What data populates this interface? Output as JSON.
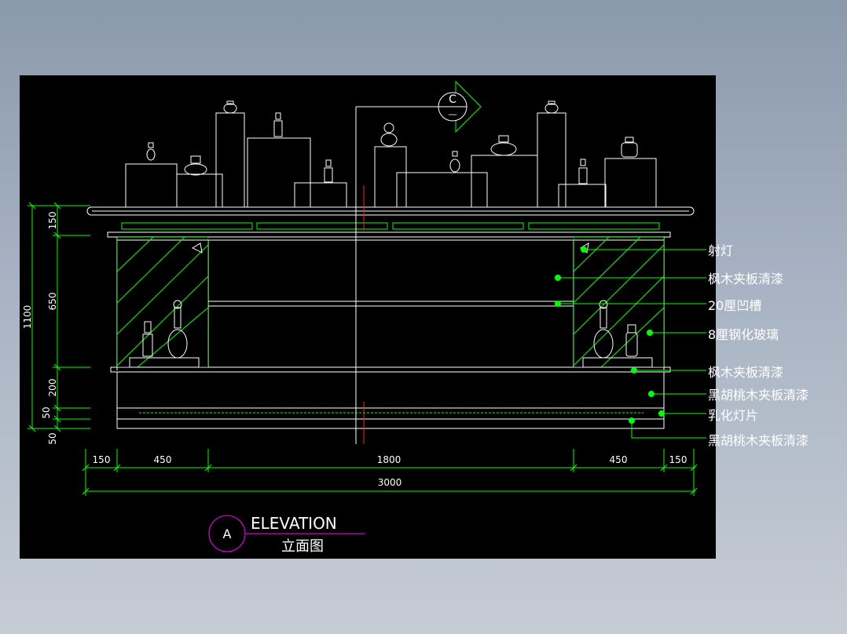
{
  "section_marker": {
    "letter": "C",
    "sub": "—"
  },
  "callouts": [
    "射灯",
    "枫木夹板清漆",
    "20厘凹槽",
    "8厘钢化玻璃",
    "枫木夹板清漆",
    "黑胡桃木夹板清漆",
    "乳化灯片",
    "黑胡桃木夹板清漆"
  ],
  "dims_left": [
    "150",
    "650",
    "1100",
    "200",
    "50",
    "50"
  ],
  "dims_bottom": [
    "150",
    "450",
    "1800",
    "450",
    "150"
  ],
  "dim_total": "3000",
  "title_block": {
    "letter": "A",
    "title_en": "ELEVATION",
    "title_cn": "立面图"
  },
  "colors": {
    "background": "#000000",
    "line_white": "#ffffff",
    "line_green": "#00ff00",
    "dim_green": "#00ff00",
    "center_red": "#ff2020",
    "title_magenta": "#ff00ff"
  }
}
